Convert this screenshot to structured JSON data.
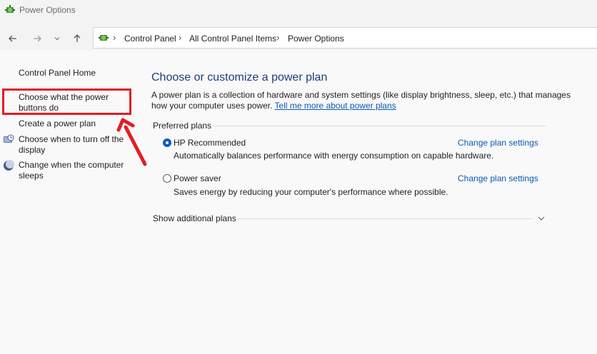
{
  "window": {
    "title": "Power Options",
    "icon": "power-options-icon"
  },
  "nav": {
    "back_icon": "back-arrow-icon",
    "forward_icon": "forward-arrow-icon",
    "recent_icon": "chevron-down-icon",
    "up_icon": "up-arrow-icon"
  },
  "breadcrumb": [
    "Control Panel",
    "All Control Panel Items",
    "Power Options"
  ],
  "left_pane": {
    "home": "Control Panel Home",
    "items": [
      {
        "label_line1": "Choose what the power",
        "label_line2": "buttons do"
      },
      {
        "label_line1": "Create a power plan"
      },
      {
        "label_line1": "Choose when to turn off the",
        "label_line2": "display",
        "icon": "monitor-clock-icon"
      },
      {
        "label_line1": "Change when the computer",
        "label_line2": "sleeps",
        "icon": "moon-icon"
      }
    ]
  },
  "main": {
    "heading": "Choose or customize a power plan",
    "desc_line1": "A power plan is a collection of hardware and system settings (like display brightness, sleep, etc.) that manages",
    "desc_line2_prefix": "how your computer uses power. ",
    "desc_link": "Tell me more about power plans",
    "preferred_label": "Preferred plans",
    "plans": [
      {
        "name": "HP Recommended",
        "selected": true,
        "description": "Automatically balances performance with energy consumption on capable hardware.",
        "link": "Change plan settings"
      },
      {
        "name": "Power saver",
        "selected": false,
        "description": "Saves energy by reducing your computer's performance where possible.",
        "link": "Change plan settings"
      }
    ],
    "additional_label": "Show additional plans"
  },
  "annotation": {
    "box_color": "#e31e24",
    "arrow_color": "#e31e24"
  }
}
